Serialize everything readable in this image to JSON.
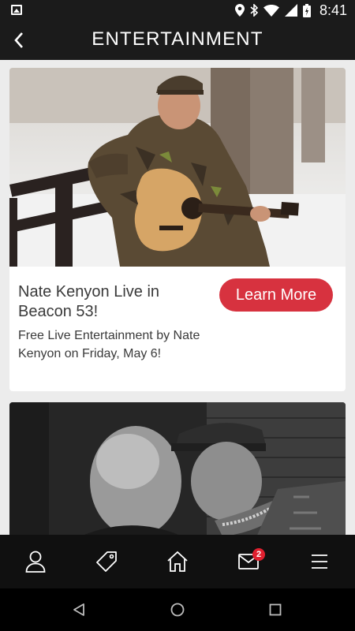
{
  "status_bar": {
    "time": "8:41",
    "icons": [
      "image-icon",
      "location-icon",
      "bluetooth-icon",
      "wifi-icon",
      "signal-icon",
      "battery-icon"
    ]
  },
  "header": {
    "title": "ENTERTAINMENT",
    "back_icon": "back-arrow-icon"
  },
  "cards": [
    {
      "title": "Nate Kenyon Live in Beacon 53!",
      "description": "Free Live Entertainment by Nate Kenyon on Friday, May 6!",
      "button_label": "Learn More",
      "image": "photo of man in camo jacket holding acoustic guitar leaning on fence"
    },
    {
      "image": "black and white photo of two men"
    }
  ],
  "bottom_nav": {
    "items": [
      {
        "icon": "profile-icon"
      },
      {
        "icon": "tag-icon"
      },
      {
        "icon": "home-icon"
      },
      {
        "icon": "mail-icon",
        "badge": "2"
      },
      {
        "icon": "menu-icon"
      }
    ]
  },
  "system_nav": {
    "icons": [
      "back-triangle-icon",
      "home-circle-icon",
      "recents-square-icon"
    ]
  },
  "colors": {
    "header_bg": "#1b1b1b",
    "accent": "#d7323f",
    "badge": "#e0202f",
    "page_bg": "#ececec"
  }
}
